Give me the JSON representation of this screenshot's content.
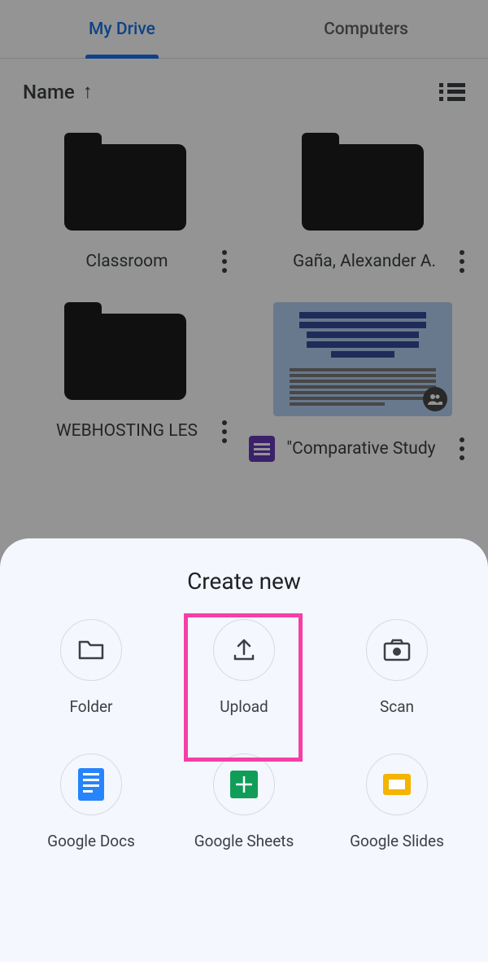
{
  "tabs": {
    "active": "My Drive",
    "inactive": "Computers"
  },
  "sort": {
    "label": "Name",
    "direction": "asc"
  },
  "files": [
    {
      "type": "folder",
      "label": "Classroom"
    },
    {
      "type": "folder",
      "label": "Gaña, Alexander A."
    },
    {
      "type": "folder",
      "label": "WEBHOSTING LES"
    },
    {
      "type": "document",
      "label": "\"Comparative Study",
      "shared": true,
      "kind": "forms"
    }
  ],
  "sheet": {
    "title": "Create new",
    "items": [
      {
        "icon": "folder-outline",
        "label": "Folder"
      },
      {
        "icon": "upload",
        "label": "Upload",
        "highlighted": true
      },
      {
        "icon": "camera",
        "label": "Scan"
      },
      {
        "icon": "google-docs",
        "label": "Google Docs"
      },
      {
        "icon": "google-sheets",
        "label": "Google Sheets"
      },
      {
        "icon": "google-slides",
        "label": "Google Slides"
      }
    ]
  }
}
